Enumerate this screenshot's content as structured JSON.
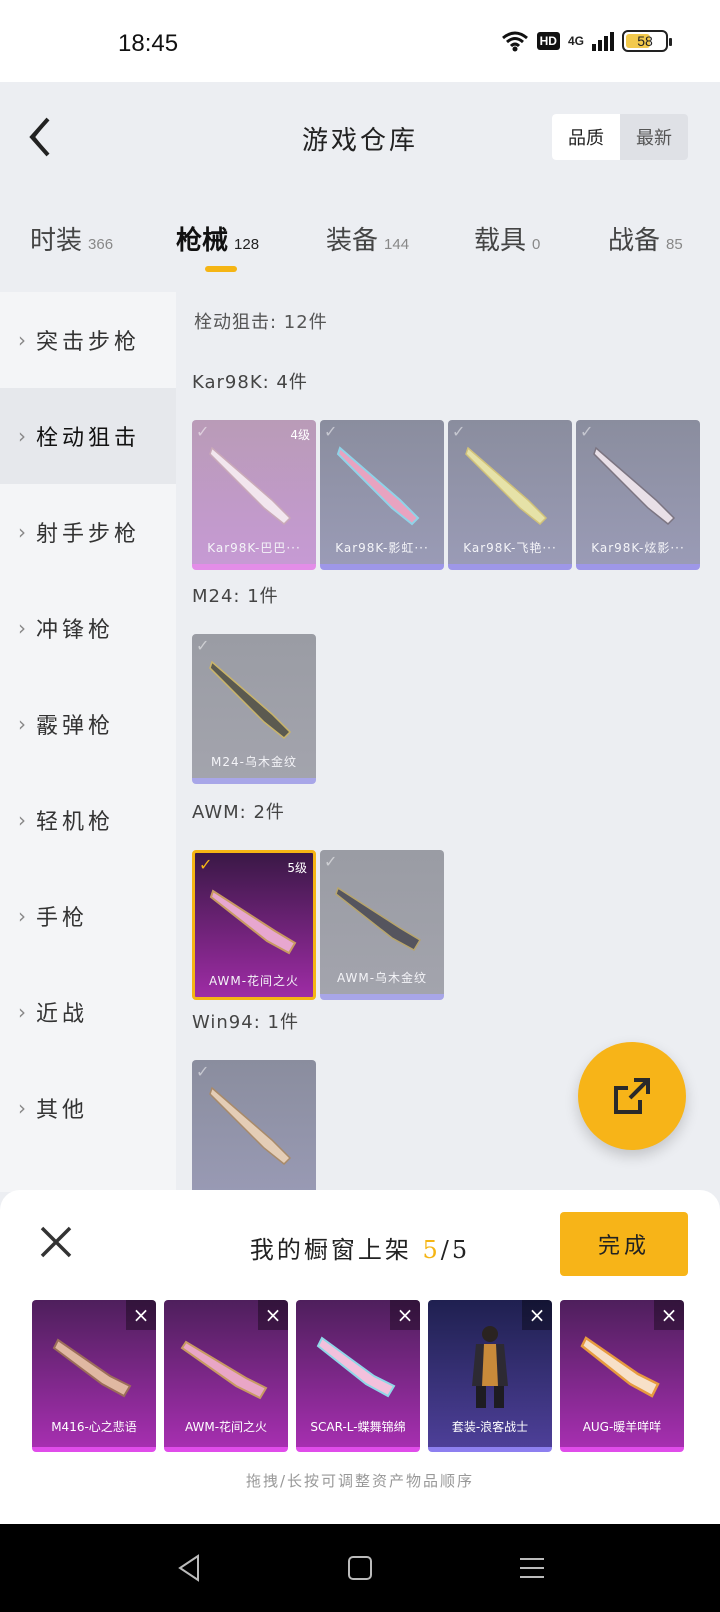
{
  "status": {
    "time": "18:45",
    "hd": "HD",
    "network": "4G",
    "battery": "58"
  },
  "header": {
    "title": "游戏仓库",
    "sort_options": [
      "品质",
      "最新"
    ]
  },
  "tabs": [
    {
      "label": "时装",
      "count": "366"
    },
    {
      "label": "枪械",
      "count": "128"
    },
    {
      "label": "装备",
      "count": "144"
    },
    {
      "label": "载具",
      "count": "0"
    },
    {
      "label": "战备",
      "count": "85"
    }
  ],
  "sidebar": {
    "items": [
      {
        "label": "突击步枪"
      },
      {
        "label": "栓动狙击"
      },
      {
        "label": "射手步枪"
      },
      {
        "label": "冲锋枪"
      },
      {
        "label": "霰弹枪"
      },
      {
        "label": "轻机枪"
      },
      {
        "label": "手枪"
      },
      {
        "label": "近战"
      },
      {
        "label": "其他"
      }
    ]
  },
  "main": {
    "summary": "栓动狙击: 12件",
    "groups": [
      {
        "label": "Kar98K: 4件",
        "cards": [
          {
            "name": "Kar98K-巴巴···",
            "level": "4级"
          },
          {
            "name": "Kar98K-影虹···",
            "level": ""
          },
          {
            "name": "Kar98K-飞艳···",
            "level": ""
          },
          {
            "name": "Kar98K-炫影···",
            "level": ""
          }
        ]
      },
      {
        "label": "M24: 1件",
        "cards": [
          {
            "name": "M24-乌木金纹",
            "level": ""
          }
        ]
      },
      {
        "label": "AWM: 2件",
        "cards": [
          {
            "name": "AWM-花间之火",
            "level": "5级"
          },
          {
            "name": "AWM-乌木金纹",
            "level": ""
          }
        ]
      },
      {
        "label": "Win94: 1件",
        "cards": [
          {
            "name": "",
            "level": ""
          }
        ]
      }
    ]
  },
  "shelf": {
    "title_prefix": "我的橱窗上架",
    "count_current": "5",
    "count_total": "/5",
    "done_label": "完成",
    "items": [
      {
        "name": "M416-心之悲语"
      },
      {
        "name": "AWM-花间之火"
      },
      {
        "name": "SCAR-L-蝶舞锦绵"
      },
      {
        "name": "套装-浪客战士"
      },
      {
        "name": "AUG-暖羊咩咩"
      }
    ],
    "hint": "拖拽/长按可调整资产物品顺序"
  },
  "icons": {
    "back": "chevron-left-icon",
    "close": "close-icon",
    "share": "share-icon"
  },
  "colors": {
    "accent": "#f5b514",
    "selected_border": "#f5b514"
  }
}
